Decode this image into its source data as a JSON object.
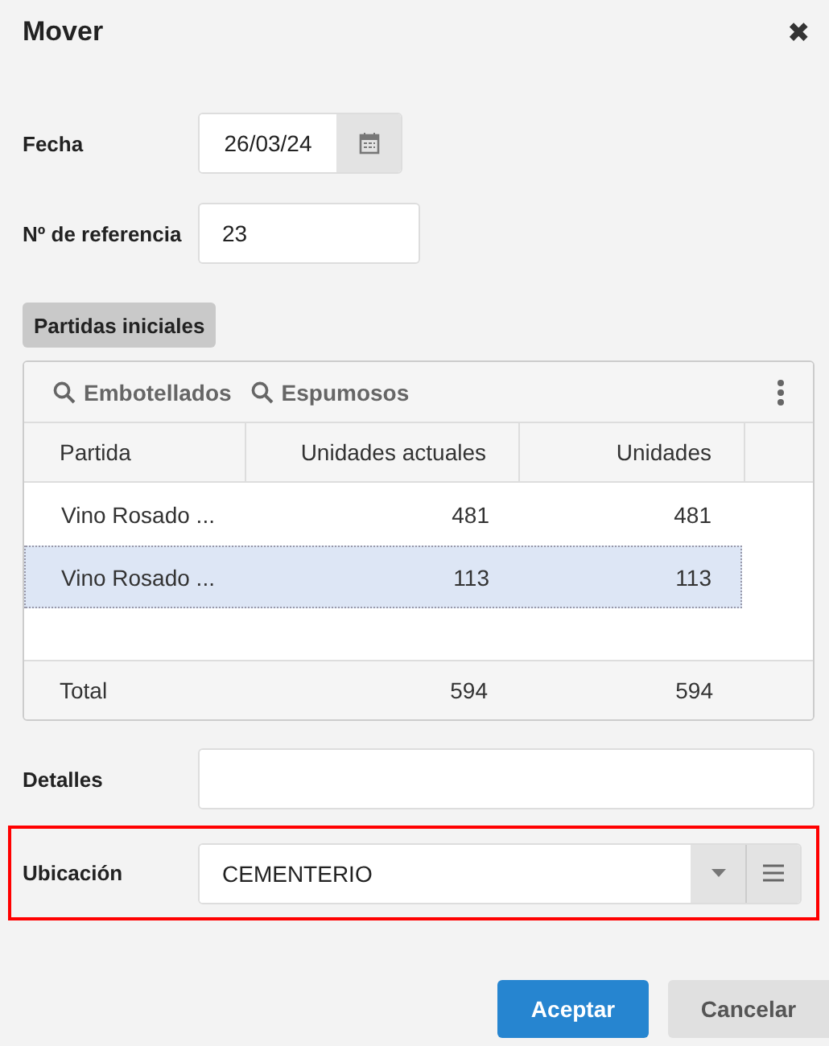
{
  "window": {
    "title": "Mover",
    "close_icon": "✖"
  },
  "fecha": {
    "label": "Fecha",
    "value": "26/03/24"
  },
  "referencia": {
    "label": "Nº de referencia",
    "value": "23"
  },
  "section_button": "Partidas iniciales",
  "table": {
    "toolbar": [
      "Embotellados",
      "Espumosos"
    ],
    "columns": [
      "Partida",
      "Unidades actuales",
      "Unidades"
    ],
    "rows": [
      {
        "cells": [
          "Vino Rosado ...",
          "481",
          "481"
        ],
        "selected": false
      },
      {
        "cells": [
          "Vino Rosado ...",
          "113",
          "113"
        ],
        "selected": true
      }
    ],
    "total": [
      "Total",
      "594",
      "594"
    ]
  },
  "detalles": {
    "label": "Detalles"
  },
  "ubicacion": {
    "label": "Ubicación",
    "value": "CEMENTERIO",
    "highlighted": true
  },
  "buttons": [
    {
      "label": "Aceptar",
      "kind": "primary"
    },
    {
      "label": "Cancelar",
      "kind": "secondary"
    }
  ]
}
